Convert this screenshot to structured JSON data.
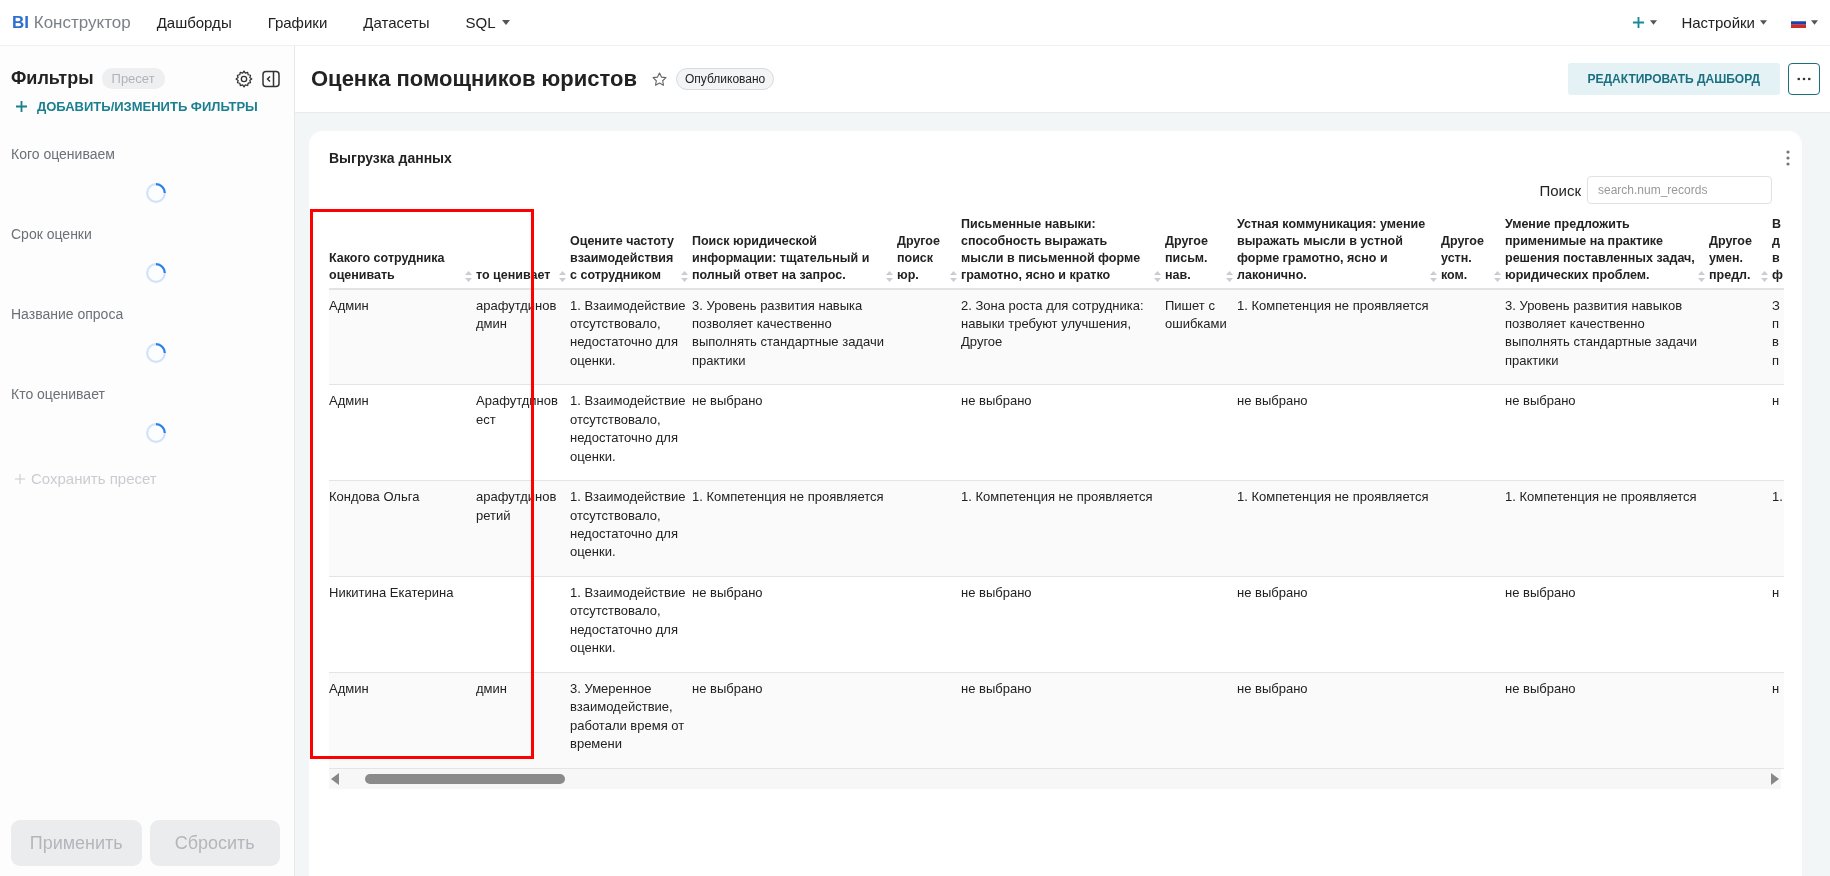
{
  "topbar": {
    "logo_mark": "BI",
    "logo_text": "Конструктор",
    "nav": [
      {
        "label": "Дашборды",
        "dropdown": false
      },
      {
        "label": "Графики",
        "dropdown": false
      },
      {
        "label": "Датасеты",
        "dropdown": false
      },
      {
        "label": "SQL",
        "dropdown": true
      }
    ],
    "settings_label": "Настройки"
  },
  "sidebar": {
    "title": "Фильтры",
    "preset_badge": "Пресет",
    "add_filters": "ДОБАВИТЬ/ИЗМЕНИТЬ ФИЛЬТРЫ",
    "filters": [
      {
        "label": "Кого оцениваем",
        "loading": true
      },
      {
        "label": "Срок оценки",
        "loading": true
      },
      {
        "label": "Название опроса",
        "loading": true
      },
      {
        "label": "Кто оценивает",
        "loading": true
      }
    ],
    "save_preset": {
      "label": "Сохранить пресет",
      "disabled": true
    },
    "buttons": [
      {
        "label": "Применить",
        "disabled": true
      },
      {
        "label": "Сбросить",
        "disabled": true
      }
    ]
  },
  "dashboard": {
    "title": "Оценка помощников юристов",
    "starred": false,
    "status": "Опубликовано",
    "edit_button": "РЕДАКТИРОВАТЬ ДАШБОРД"
  },
  "widget": {
    "title": "Выгрузка данных",
    "search_label": "Поиск",
    "search_placeholder": "search.num_records",
    "columns": [
      {
        "label": "Какого сотрудника оценивать",
        "sortable": true
      },
      {
        "label": "то ценивает",
        "sortable": true
      },
      {
        "label": "Оцените частоту взаимодействия с сотрудником",
        "sortable": true
      },
      {
        "label": "Поиск юридической информации: тщательный и полный ответ на запрос.",
        "sortable": true
      },
      {
        "label": "Другое поиск юр.",
        "sortable": true
      },
      {
        "label": "Письменные навыки: способность выражать мысли в письменной форме грамотно, ясно и кратко",
        "sortable": true
      },
      {
        "label": "Другое письм. нав.",
        "sortable": true
      },
      {
        "label": "Устная коммуникация: умение выражать мысли в устной форме грамотно, ясно и лаконично.",
        "sortable": true
      },
      {
        "label": "Другое устн. ком.",
        "sortable": true
      },
      {
        "label": "Умение предложить применимые на практике решения поставленных задач, юридических проблем.",
        "sortable": true
      },
      {
        "label": "Другое умен. предл.",
        "sortable": true
      },
      {
        "label": "В д в ф",
        "sortable": false
      }
    ],
    "rows": [
      {
        "cells": [
          "Админ",
          "арафутдинов дмин",
          "1. Взаимодействие отсутствовало, недостаточно для оценки.",
          "3. Уровень развития навыка позволяет качественно выполнять стандартные задачи практики",
          null,
          "2. Зона роста для сотрудника: навыки требуют улучшения, Другое",
          "Пишет с ошибками",
          "1. Компетенция не проявляется",
          null,
          "3. Уровень развития навыков позволяет качественно выполнять стандартные задачи практики",
          null,
          "З п в п"
        ]
      },
      {
        "cells": [
          "Админ",
          "Арафутдинов ест",
          "1. Взаимодействие отсутствовало, недостаточно для оценки.",
          "не выбрано",
          null,
          "не выбрано",
          null,
          "не выбрано",
          null,
          "не выбрано",
          null,
          "н"
        ]
      },
      {
        "cells": [
          "Кондова Ольга",
          "арафутдинов ретий",
          "1. Взаимодействие отсутствовало, недостаточно для оценки.",
          "1. Компетенция не проявляется",
          null,
          "1. Компетенция не проявляется",
          null,
          "1. Компетенция не проявляется",
          null,
          "1. Компетенция не проявляется",
          null,
          "1."
        ]
      },
      {
        "cells": [
          "Никитина Екатерина",
          null,
          "1. Взаимодействие отсутствовало, недостаточно для оценки.",
          "не выбрано",
          null,
          "не выбрано",
          null,
          "не выбрано",
          null,
          "не выбрано",
          null,
          "н"
        ]
      },
      {
        "cells": [
          "Админ",
          "дмин",
          "3. Умеренное взаимодействие, работали время от времени",
          "не выбрано",
          null,
          "не выбрано",
          null,
          "не выбрано",
          null,
          "не выбрано",
          null,
          "н"
        ]
      }
    ]
  },
  "annotations": [
    {
      "kind": "rectangle"
    }
  ]
}
